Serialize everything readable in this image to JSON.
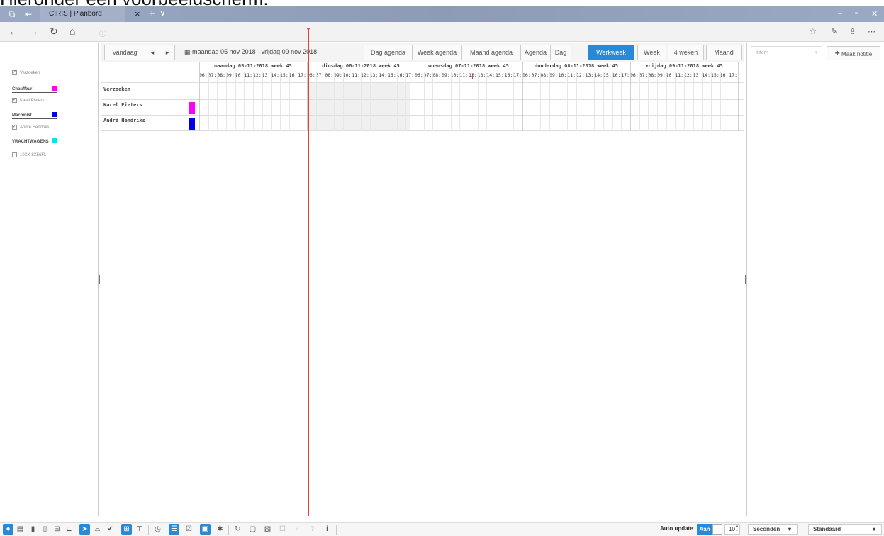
{
  "heading": "Hieronder een voorbeeldscherm:",
  "browser": {
    "tab_title": "CIRIS | Planbord",
    "tab_close": "×",
    "new_tab": "+",
    "tab_list": "∨",
    "minimize": "–",
    "maximize": "▫",
    "close": "✕"
  },
  "toolbar": {
    "today": "Vandaag",
    "prev": "◂",
    "next": "▸",
    "date_range": "maandag 05 nov 2018 - vrijdag 09 nov 2018",
    "views": [
      "Dag agenda",
      "Week agenda",
      "Maand agenda",
      "Agenda",
      "Dag",
      "Werkweek",
      "Week",
      "4 weken",
      "Maand"
    ],
    "active_view": "Werkweek"
  },
  "filters": {
    "verzoeken": "Verzoeken",
    "groups": [
      {
        "name": "Chauffeur",
        "color": "#ff00ff",
        "items": [
          "Karel Pieters"
        ]
      },
      {
        "name": "Machinist",
        "color": "#0000ee",
        "items": [
          "André Hendriks"
        ]
      },
      {
        "name": "VRACHTWAGENS",
        "color": "#00e5ee",
        "items": [
          "10XX 8X56FL"
        ]
      }
    ]
  },
  "schedule": {
    "days": [
      "maandag 05-11-2018 week 45",
      "dinsdag 06-11-2018 week 45",
      "woensdag 07-11-2018 week 45",
      "donderdag 08-11-2018 week 45",
      "vrijdag 09-11-2018 week 45"
    ],
    "hours": [
      "06:",
      "07:",
      "08:",
      "09:",
      "10:",
      "11:",
      "12:",
      "13:",
      "14:",
      "15:",
      "16:",
      "17:"
    ],
    "rows": [
      {
        "label": "Verzoeken",
        "color": ""
      },
      {
        "label": "Karel Pieters",
        "color": "#ff00ff"
      },
      {
        "label": "André Hendriks",
        "color": "#0000ee"
      }
    ]
  },
  "right_panel": {
    "select": "Intern",
    "note_button": "Maak notitie"
  },
  "bottom": {
    "auto_update_label": "Auto update",
    "auto_update_state": "Aan",
    "interval": "10",
    "unit": "Seconden",
    "view": "Standaard"
  }
}
